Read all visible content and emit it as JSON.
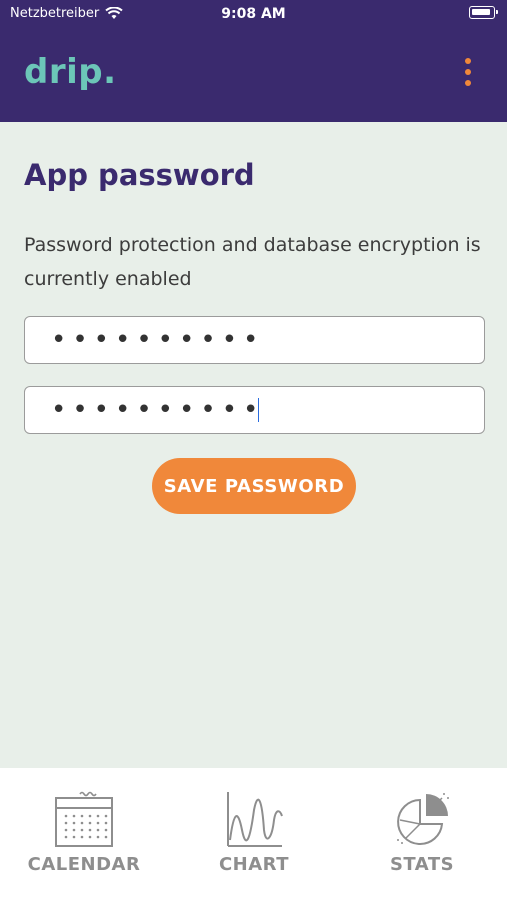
{
  "status_bar": {
    "carrier": "Netzbetreiber",
    "time": "9:08 AM"
  },
  "header": {
    "logo": "drip.",
    "menu_icon": "more-vertical-icon"
  },
  "page": {
    "title": "App password",
    "status_text": "Password protection and database encryption is currently enabled",
    "password_value": "••••••••••",
    "confirm_value": "••••••••••",
    "save_button": "SAVE PASSWORD"
  },
  "nav": {
    "items": [
      {
        "label": "CALENDAR",
        "icon": "calendar-icon"
      },
      {
        "label": "CHART",
        "icon": "chart-icon"
      },
      {
        "label": "STATS",
        "icon": "stats-icon"
      }
    ]
  },
  "colors": {
    "header": "#3a2a6e",
    "logo": "#6cc6b8",
    "accent": "#f0883a",
    "background": "#e8efe9",
    "nav_icon": "#8e8e8e"
  }
}
